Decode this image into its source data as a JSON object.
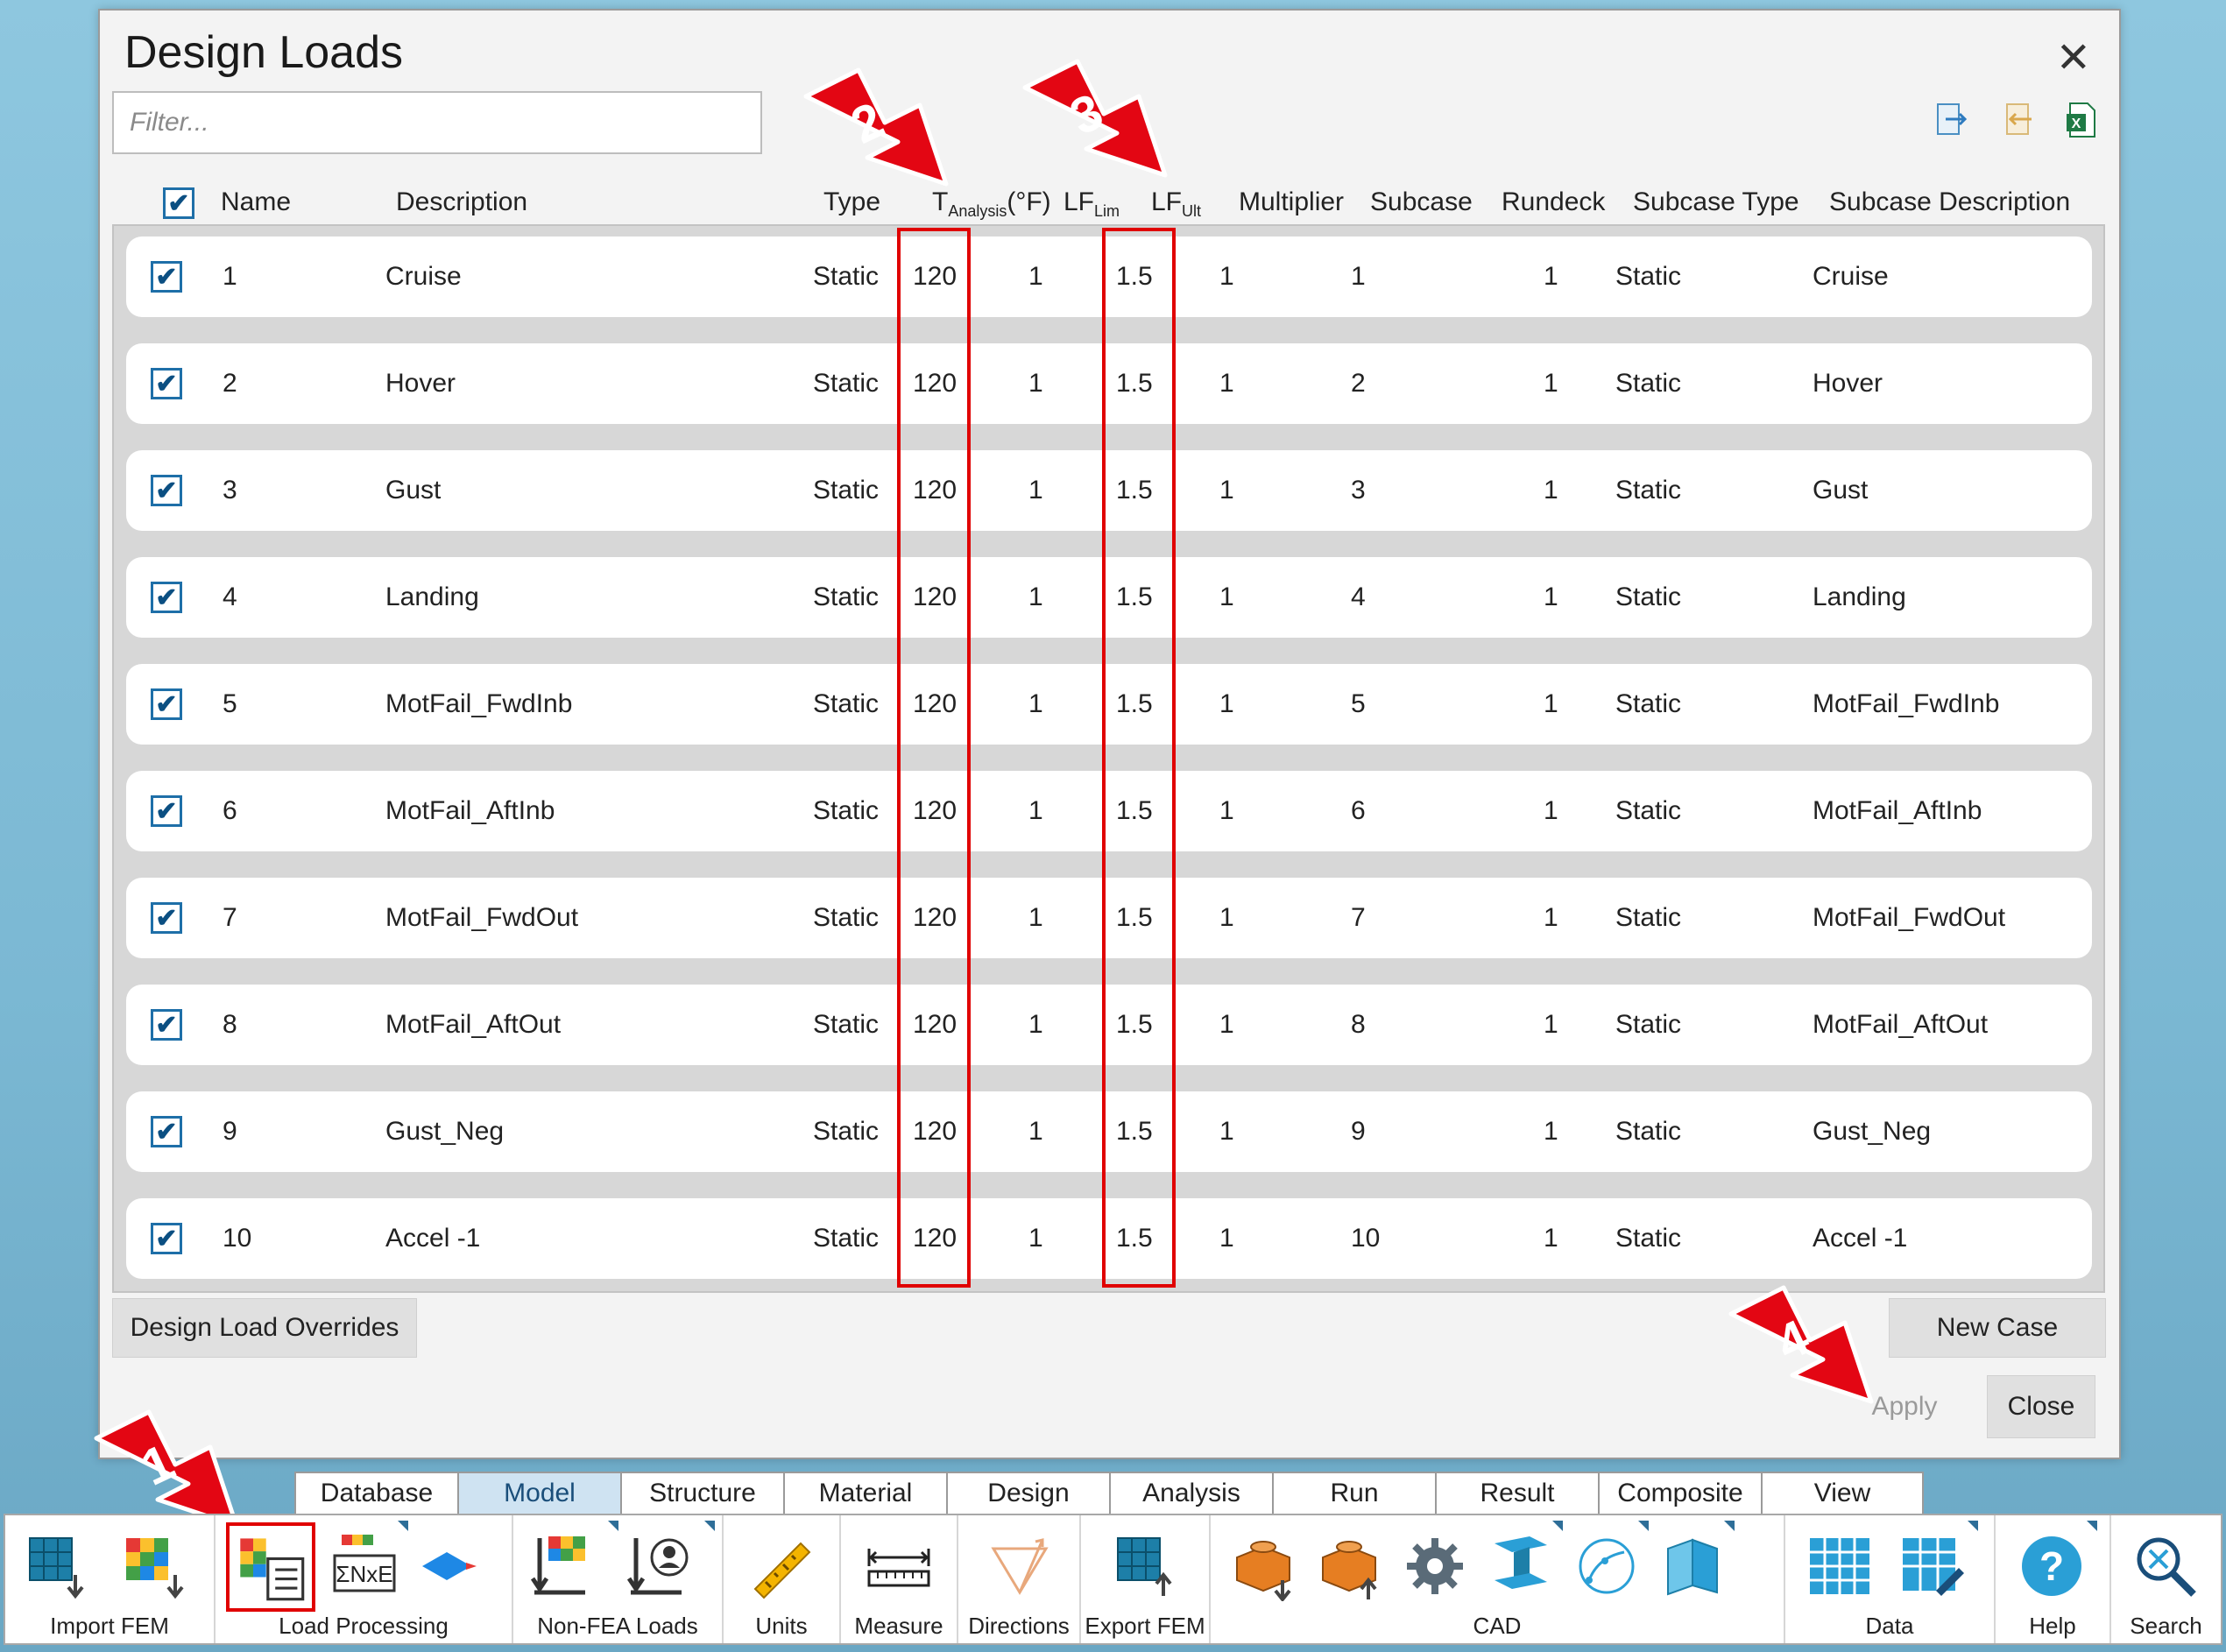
{
  "dialog": {
    "title": "Design Loads",
    "filter_placeholder": "Filter...",
    "close_symbol": "✕"
  },
  "header": {
    "name": "Name",
    "description": "Description",
    "type": "Type",
    "t_analysis_main": "T",
    "t_analysis_sub": "Analysis",
    "t_analysis_unit": "(°F)",
    "lf_lim_main": "LF",
    "lf_lim_sub": "Lim",
    "lf_ult_main": "LF",
    "lf_ult_sub": "Ult",
    "multiplier": "Multiplier",
    "subcase": "Subcase",
    "rundeck": "Rundeck",
    "subcase_type": "Subcase Type",
    "subcase_description": "Subcase Description"
  },
  "rows": [
    {
      "name": "1",
      "description": "Cruise",
      "type": "Static",
      "t_analysis": "120",
      "lf_lim": "1",
      "lf_ult": "1.5",
      "multiplier": "1",
      "subcase": "1",
      "rundeck": "1",
      "subcase_type": "Static",
      "subcase_description": "Cruise"
    },
    {
      "name": "2",
      "description": "Hover",
      "type": "Static",
      "t_analysis": "120",
      "lf_lim": "1",
      "lf_ult": "1.5",
      "multiplier": "1",
      "subcase": "2",
      "rundeck": "1",
      "subcase_type": "Static",
      "subcase_description": "Hover"
    },
    {
      "name": "3",
      "description": "Gust",
      "type": "Static",
      "t_analysis": "120",
      "lf_lim": "1",
      "lf_ult": "1.5",
      "multiplier": "1",
      "subcase": "3",
      "rundeck": "1",
      "subcase_type": "Static",
      "subcase_description": "Gust"
    },
    {
      "name": "4",
      "description": "Landing",
      "type": "Static",
      "t_analysis": "120",
      "lf_lim": "1",
      "lf_ult": "1.5",
      "multiplier": "1",
      "subcase": "4",
      "rundeck": "1",
      "subcase_type": "Static",
      "subcase_description": "Landing"
    },
    {
      "name": "5",
      "description": "MotFail_FwdInb",
      "type": "Static",
      "t_analysis": "120",
      "lf_lim": "1",
      "lf_ult": "1.5",
      "multiplier": "1",
      "subcase": "5",
      "rundeck": "1",
      "subcase_type": "Static",
      "subcase_description": "MotFail_FwdInb"
    },
    {
      "name": "6",
      "description": "MotFail_AftInb",
      "type": "Static",
      "t_analysis": "120",
      "lf_lim": "1",
      "lf_ult": "1.5",
      "multiplier": "1",
      "subcase": "6",
      "rundeck": "1",
      "subcase_type": "Static",
      "subcase_description": "MotFail_AftInb"
    },
    {
      "name": "7",
      "description": "MotFail_FwdOut",
      "type": "Static",
      "t_analysis": "120",
      "lf_lim": "1",
      "lf_ult": "1.5",
      "multiplier": "1",
      "subcase": "7",
      "rundeck": "1",
      "subcase_type": "Static",
      "subcase_description": "MotFail_FwdOut"
    },
    {
      "name": "8",
      "description": "MotFail_AftOut",
      "type": "Static",
      "t_analysis": "120",
      "lf_lim": "1",
      "lf_ult": "1.5",
      "multiplier": "1",
      "subcase": "8",
      "rundeck": "1",
      "subcase_type": "Static",
      "subcase_description": "MotFail_AftOut"
    },
    {
      "name": "9",
      "description": "Gust_Neg",
      "type": "Static",
      "t_analysis": "120",
      "lf_lim": "1",
      "lf_ult": "1.5",
      "multiplier": "1",
      "subcase": "9",
      "rundeck": "1",
      "subcase_type": "Static",
      "subcase_description": "Gust_Neg"
    },
    {
      "name": "10",
      "description": "Accel -1",
      "type": "Static",
      "t_analysis": "120",
      "lf_lim": "1",
      "lf_ult": "1.5",
      "multiplier": "1",
      "subcase": "10",
      "rundeck": "1",
      "subcase_type": "Static",
      "subcase_description": "Accel -1"
    }
  ],
  "buttons": {
    "design_load_overrides": "Design Load Overrides",
    "new_case": "New Case",
    "apply": "Apply",
    "close": "Close"
  },
  "callouts": [
    "1",
    "2",
    "3",
    "4"
  ],
  "ribbon": {
    "tabs": [
      "Database",
      "Model",
      "Structure",
      "Material",
      "Design",
      "Analysis",
      "Run",
      "Result",
      "Composite",
      "View"
    ],
    "active_tab": "Model",
    "groups": {
      "import_fem": "Import FEM",
      "load_processing": "Load Processing",
      "non_fea_loads": "Non-FEA Loads",
      "units": "Units",
      "measure": "Measure",
      "directions": "Directions",
      "export_fem": "Export FEM",
      "cad": "CAD",
      "data": "Data",
      "help": "Help",
      "search": "Search"
    }
  },
  "colors": {
    "accent_blue": "#1e6fa8",
    "highlight_red": "#e00000",
    "active_tab": "#cfe3f2",
    "grid_bg": "#d7d7d7"
  }
}
